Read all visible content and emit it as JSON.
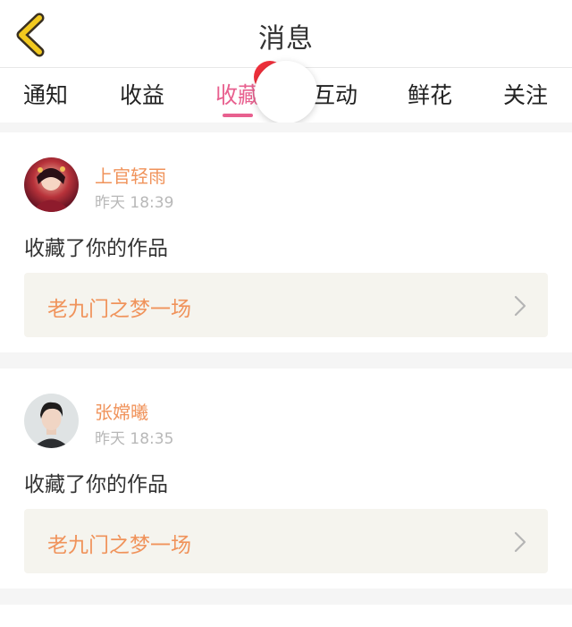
{
  "header": {
    "title": "消息",
    "back_icon": "chevron-left-icon",
    "back_color": "#f2c91f"
  },
  "tabs": [
    {
      "label": "通知",
      "active": false
    },
    {
      "label": "收益",
      "active": false
    },
    {
      "label": "收藏",
      "active": true
    },
    {
      "label": "互动",
      "active": false
    },
    {
      "label": "鲜花",
      "active": false
    },
    {
      "label": "关注",
      "active": false
    }
  ],
  "colors": {
    "accent_pink": "#e8608f",
    "username_orange": "#f0935b",
    "badge_red": "#ee2f3b",
    "work_box_bg": "#f5f4ee"
  },
  "notifications": [
    {
      "username": "上官轻雨",
      "time": "昨天 18:39",
      "action": "收藏了你的作品",
      "work_title": "老九门之梦一场",
      "avatar_icon": "avatar-image"
    },
    {
      "username": "张嫦曦",
      "time": "昨天 18:35",
      "action": "收藏了你的作品",
      "work_title": "老九门之梦一场",
      "avatar_icon": "avatar-image"
    }
  ]
}
